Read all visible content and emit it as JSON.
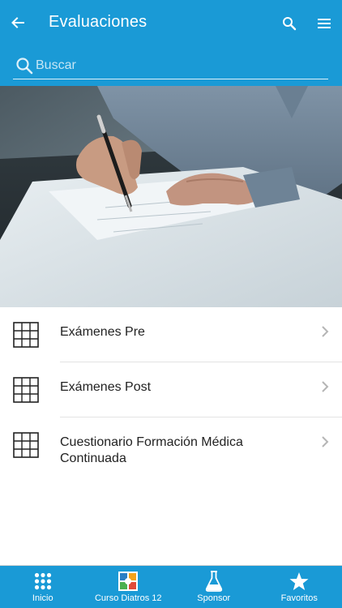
{
  "header": {
    "title": "Evaluaciones",
    "back_icon": "arrow-left-icon",
    "search_icon": "search-icon",
    "menu_icon": "hamburger-menu-icon",
    "background_color": "#1a9ad6"
  },
  "search": {
    "placeholder": "Buscar",
    "value": ""
  },
  "list": {
    "items": [
      {
        "label": "Exámenes Pre",
        "icon": "grid-table-icon"
      },
      {
        "label": "Exámenes Post",
        "icon": "grid-table-icon"
      },
      {
        "label": "Cuestionario Formación Médica Continuada",
        "icon": "grid-table-icon"
      }
    ]
  },
  "tabbar": {
    "tabs": [
      {
        "label": "Inicio",
        "icon": "dots-grid-icon"
      },
      {
        "label": "Curso Diatros 12",
        "icon": "diatros-logo-icon"
      },
      {
        "label": "Sponsor",
        "icon": "flask-icon"
      },
      {
        "label": "Favoritos",
        "icon": "star-icon"
      }
    ]
  }
}
